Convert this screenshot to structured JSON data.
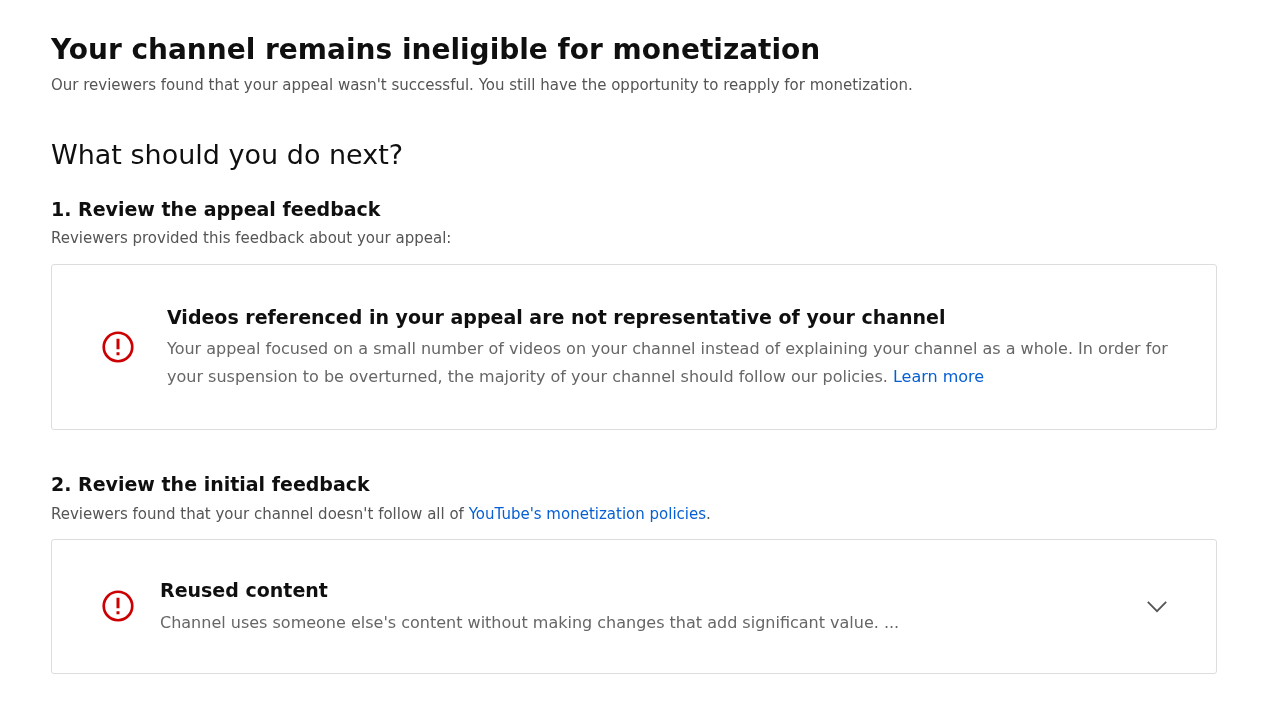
{
  "title": "Your channel remains ineligible for monetization",
  "subtitle": "Our reviewers found that your appeal wasn't successful. You still have the opportunity to reapply for monetization.",
  "next_heading": "What should you do next?",
  "steps": [
    {
      "heading": "1. Review the appeal feedback",
      "intro": "Reviewers provided this feedback about your appeal:",
      "card": {
        "title": "Videos referenced in your appeal are not representative of your channel",
        "body": "Your appeal focused on a small number of videos on your channel instead of explaining your channel as a whole. In order for your suspension to be overturned, the majority of your channel should follow our policies.",
        "link": "Learn more"
      }
    },
    {
      "heading": "2. Review the initial feedback",
      "intro": "Reviewers found that your channel doesn't follow all of",
      "intro_link": "YouTube's monetization policies",
      "intro_end": ".",
      "card": {
        "title": "Reused content",
        "body": "Channel uses someone else's content without making changes that add significant value. ...",
        "expanded": false
      }
    }
  ]
}
